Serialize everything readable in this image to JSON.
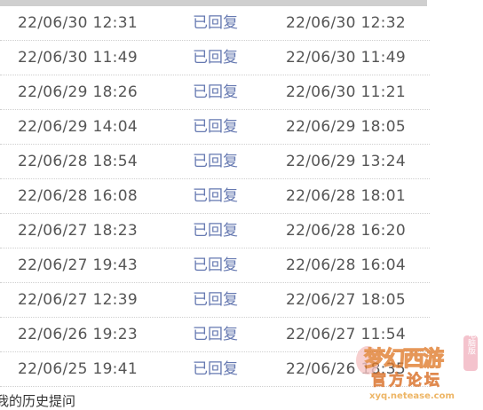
{
  "rows": [
    {
      "submitted": "22/06/30 12:31",
      "status": "已回复",
      "replied": "22/06/30 12:32"
    },
    {
      "submitted": "22/06/30 11:49",
      "status": "已回复",
      "replied": "22/06/30 11:49"
    },
    {
      "submitted": "22/06/29 18:26",
      "status": "已回复",
      "replied": "22/06/30 11:21"
    },
    {
      "submitted": "22/06/29 14:04",
      "status": "已回复",
      "replied": "22/06/29 18:05"
    },
    {
      "submitted": "22/06/28 18:54",
      "status": "已回复",
      "replied": "22/06/29 13:24"
    },
    {
      "submitted": "22/06/28 16:08",
      "status": "已回复",
      "replied": "22/06/28 18:01"
    },
    {
      "submitted": "22/06/27 18:23",
      "status": "已回复",
      "replied": "22/06/28 16:20"
    },
    {
      "submitted": "22/06/27 19:43",
      "status": "已回复",
      "replied": "22/06/28 16:04"
    },
    {
      "submitted": "22/06/27 12:39",
      "status": "已回复",
      "replied": "22/06/27 18:05"
    },
    {
      "submitted": "22/06/26 19:23",
      "status": "已回复",
      "replied": "22/06/27 11:54"
    },
    {
      "submitted": "22/06/25 19:41",
      "status": "已回复",
      "replied": "22/06/26 18:35"
    }
  ],
  "footer": {
    "link_text": "我的历史提问"
  },
  "watermark": {
    "title": "梦幻西游",
    "edition": "电脑版",
    "subtitle": "官方论坛",
    "url": "xyq.netease.com"
  },
  "colors": {
    "status_link": "#6679b1",
    "timestamp_text": "#555555",
    "row_divider": "#cfcfcf"
  }
}
